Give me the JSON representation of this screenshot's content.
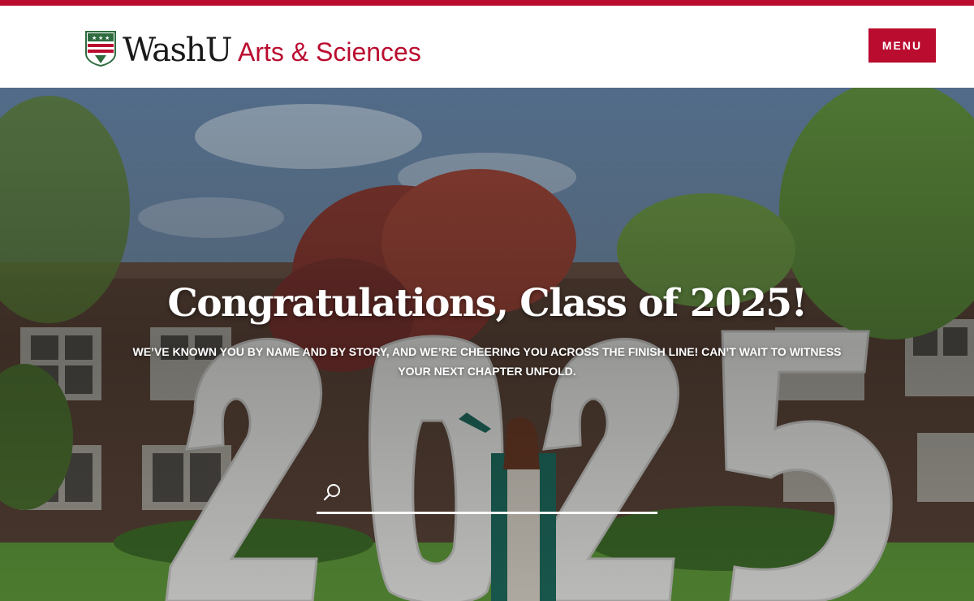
{
  "header": {
    "logo": {
      "main_text": "WashU",
      "sub_text": "Arts & Sciences"
    },
    "menu_label": "MENU"
  },
  "hero": {
    "title": "Congratulations, Class of 2025!",
    "subtitle": "We’ve known you by name and by story, and we’re cheering you across the finish line! Can’t wait to witness your next chapter unfold.",
    "background_numbers": "2025",
    "search": {
      "placeholder": "",
      "icon": "search-icon"
    }
  },
  "colors": {
    "brand_red": "#ba0c2f",
    "text_dark": "#1a1a1a",
    "white": "#ffffff"
  }
}
